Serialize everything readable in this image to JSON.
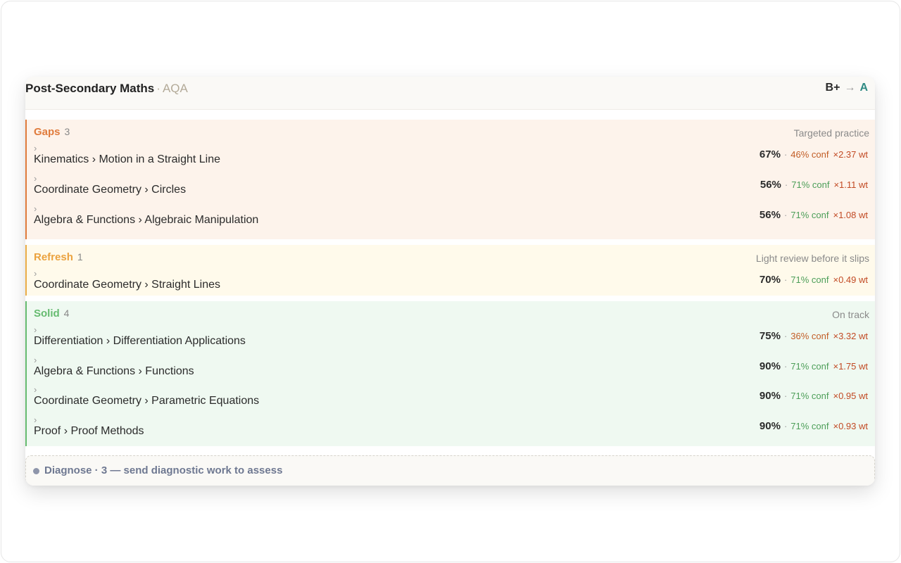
{
  "header": {
    "title": "Post-Secondary Maths",
    "separator": "·",
    "board": "AQA",
    "grade_current": "B+",
    "grade_arrow": "→",
    "grade_target": "A"
  },
  "sections": {
    "gaps": {
      "name": "Gaps",
      "count": "3",
      "note": "Targeted practice",
      "accent": "#e07b3c",
      "rows": [
        {
          "chevron": "›",
          "topic": "Kinematics › Motion in a Straight Line",
          "pct": "67%",
          "sep": "·",
          "conf": "46% conf",
          "wt": "×2.37 wt"
        },
        {
          "chevron": "›",
          "topic": "Coordinate Geometry › Circles",
          "pct": "56%",
          "sep": "·",
          "conf": "71% conf",
          "wt": "×1.11 wt"
        },
        {
          "chevron": "›",
          "topic": "Algebra & Functions › Algebraic Manipulation",
          "pct": "56%",
          "sep": "·",
          "conf": "71% conf",
          "wt": "×1.08 wt"
        }
      ]
    },
    "refresh": {
      "name": "Refresh",
      "count": "1",
      "note": "Light review before it slips",
      "accent": "#ebae48",
      "rows": [
        {
          "chevron": "›",
          "topic": "Coordinate Geometry › Straight Lines",
          "pct": "70%",
          "sep": "·",
          "conf": "71% conf",
          "wt": "×0.49 wt"
        }
      ]
    },
    "solid": {
      "name": "Solid",
      "count": "4",
      "note": "On track",
      "accent": "#66bb70",
      "rows": [
        {
          "chevron": "›",
          "topic": "Differentiation › Differentiation Applications",
          "pct": "75%",
          "sep": "·",
          "conf": "36% conf",
          "wt": "×3.32 wt"
        },
        {
          "chevron": "›",
          "topic": "Algebra & Functions › Functions",
          "pct": "90%",
          "sep": "·",
          "conf": "71% conf",
          "wt": "×1.75 wt"
        },
        {
          "chevron": "›",
          "topic": "Coordinate Geometry › Parametric Equations",
          "pct": "90%",
          "sep": "·",
          "conf": "71% conf",
          "wt": "×0.95 wt"
        },
        {
          "chevron": "›",
          "topic": "Proof › Proof Methods",
          "pct": "90%",
          "sep": "·",
          "conf": "71% conf",
          "wt": "×0.93 wt"
        }
      ]
    }
  },
  "diagnose": {
    "text": "Diagnose · 3 — send diagnostic work to assess"
  }
}
